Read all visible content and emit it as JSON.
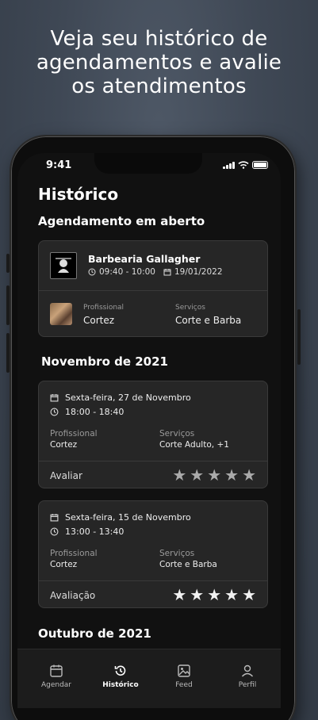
{
  "headline": [
    "Veja seu histórico de",
    "agendamentos e avalie",
    "os atendimentos"
  ],
  "status": {
    "time": "9:41"
  },
  "page_title": "Histórico",
  "open": {
    "section_title": "Agendamento em aberto",
    "shop": "Barbearia Gallagher",
    "time": "09:40 - 10:00",
    "date": "19/01/2022",
    "prof_label": "Profissional",
    "prof_value": "Cortez",
    "serv_label": "Serviços",
    "serv_value": "Corte e Barba"
  },
  "month1": "Novembro de 2021",
  "history": [
    {
      "date": "Sexta-feira, 27 de Novembro",
      "time": "18:00 - 18:40",
      "prof_label": "Profissional",
      "prof_value": "Cortez",
      "serv_label": "Serviços",
      "serv_value": "Corte Adulto, +1",
      "rate_label": "Avaliar",
      "rating": 0
    },
    {
      "date": "Sexta-feira, 15 de Novembro",
      "time": "13:00 - 13:40",
      "prof_label": "Profissional",
      "prof_value": "Cortez",
      "serv_label": "Serviços",
      "serv_value": "Corte e Barba",
      "rate_label": "Avaliação",
      "rating": 5
    }
  ],
  "month2": "Outubro de 2021",
  "tabs": [
    {
      "label": "Agendar",
      "icon": "calendar-icon"
    },
    {
      "label": "Histórico",
      "icon": "history-icon",
      "active": true
    },
    {
      "label": "Feed",
      "icon": "image-icon"
    },
    {
      "label": "Perfil",
      "icon": "user-icon"
    }
  ]
}
